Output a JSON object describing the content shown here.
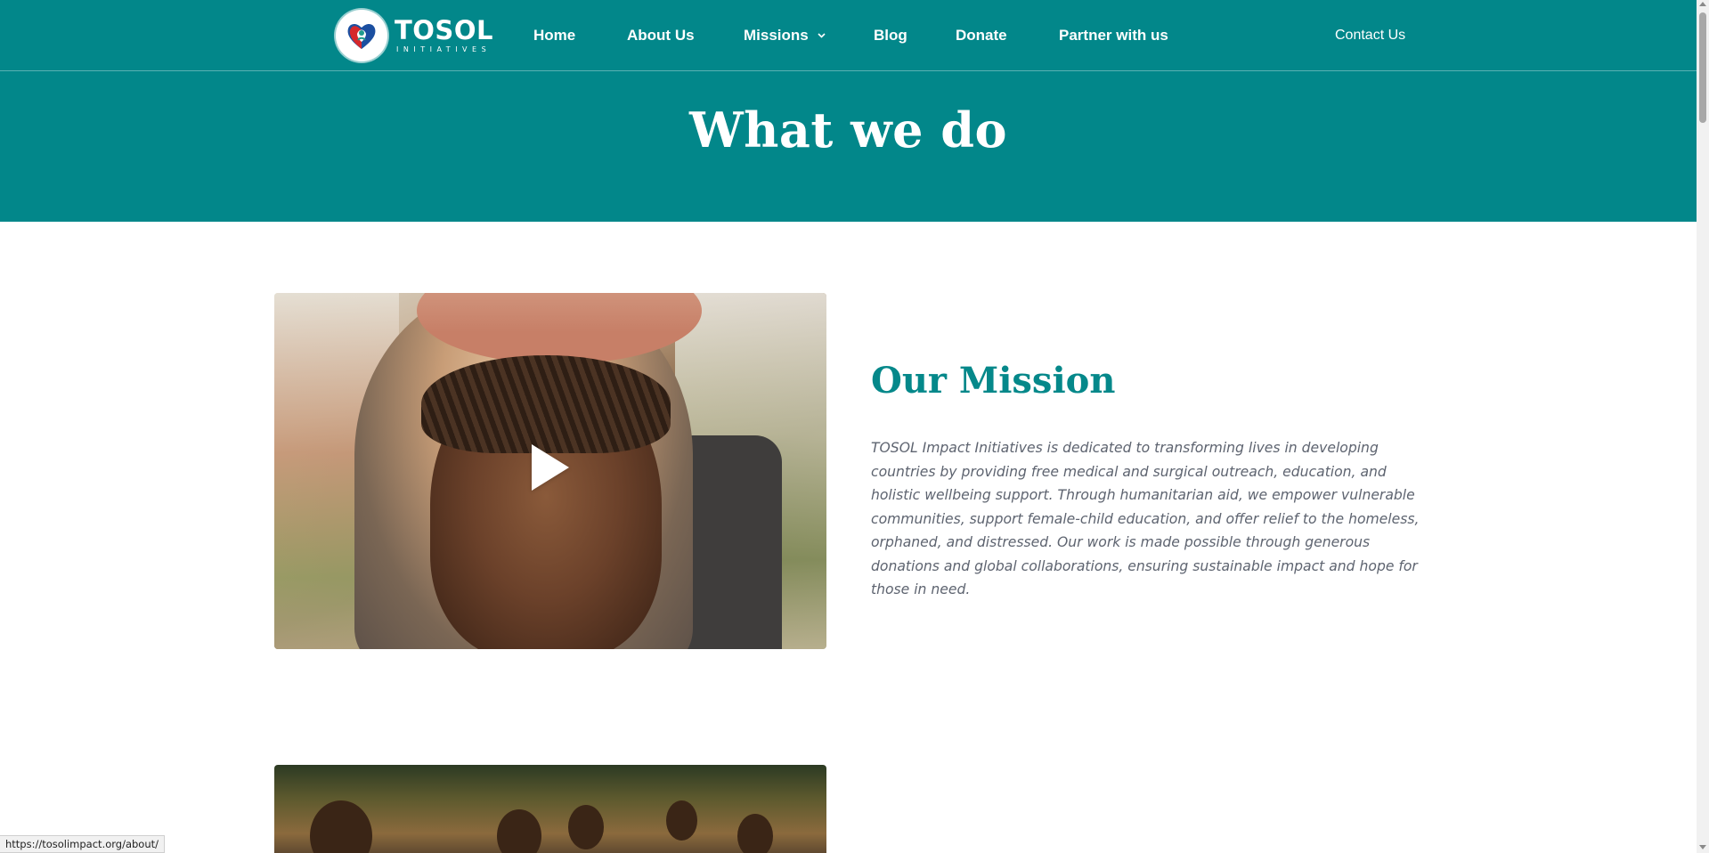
{
  "header": {
    "brand": {
      "name": "TOSOL",
      "sub": "INITIATIVES"
    },
    "nav": [
      {
        "label": "Home"
      },
      {
        "label": "About Us"
      },
      {
        "label": "Missions"
      },
      {
        "label": "Blog"
      },
      {
        "label": "Donate"
      },
      {
        "label": "Partner with us"
      }
    ],
    "contact_label": "Contact Us"
  },
  "hero": {
    "title": "What we do"
  },
  "mission": {
    "title": "Our Mission",
    "body": "TOSOL Impact Initiatives is dedicated to transforming lives in developing countries by providing free medical and surgical outreach, education, and holistic wellbeing support. Through humanitarian aid, we empower vulnerable communities, support female-child education, and offer relief to the homeless, orphaned, and distressed. Our work is made possible through generous donations and global collaborations, ensuring sustainable impact and hope for those in need."
  },
  "status_bar": {
    "url": "https://tosolimpact.org/about/"
  },
  "colors": {
    "brand_teal": "#02878a",
    "heading_teal": "#05888a",
    "body_gray": "#5e6470"
  }
}
